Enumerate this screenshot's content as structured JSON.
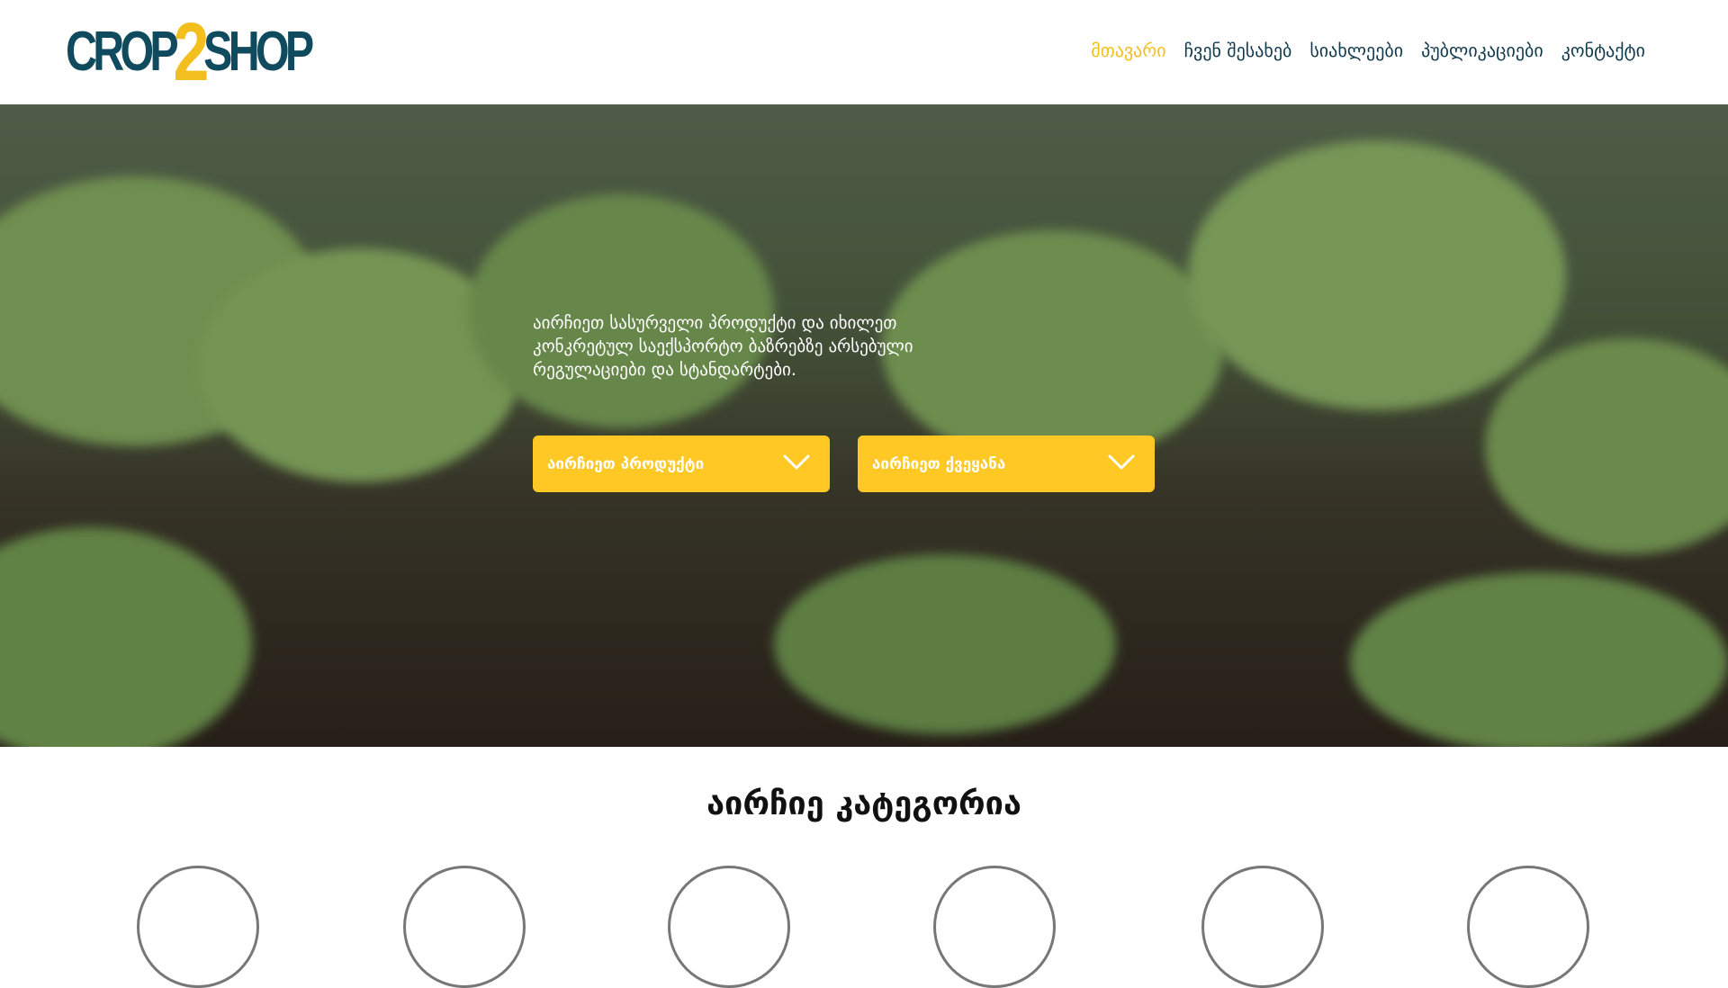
{
  "brand": {
    "logo_left": "CROP",
    "logo_mid": "2",
    "logo_right": "SHOP"
  },
  "nav": {
    "items": [
      {
        "label": "მთავარი"
      },
      {
        "label": "ჩვენ შესახებ"
      },
      {
        "label": "სიახლეები"
      },
      {
        "label": "პუბლიკაციები"
      },
      {
        "label": "კონტაქტი"
      }
    ]
  },
  "hero": {
    "text": "აირჩიეთ სასურველი პროდუქტი და იხილეთ კონკრეტულ საექსპორტო ბაზრებზე არსებული რეგულაციები და სტანდარტები.",
    "product_select": {
      "value": "აირჩიეთ პროდუქტი"
    },
    "country_select": {
      "value": "აირჩიეთ ქვეყანა"
    }
  },
  "categories": {
    "title": "აირჩიე კატეგორია"
  },
  "colors": {
    "accent": "#ffc824",
    "brand": "#0f4a5e"
  }
}
